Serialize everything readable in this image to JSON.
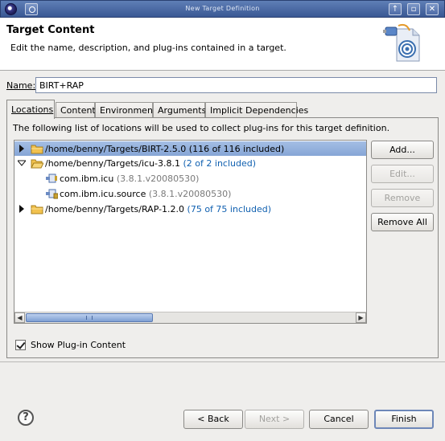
{
  "window": {
    "title": "New Target Definition",
    "app_icon": "eclipse-icon",
    "menu_icon": "window-menu-icon",
    "controls": {
      "minimize": "up-arrow-icon",
      "maximize": "maximize-icon",
      "close": "close-icon"
    }
  },
  "header": {
    "title": "Target Content",
    "description": "Edit the name, description, and plug-ins contained in a target.",
    "icon": "target-wizard-icon"
  },
  "name_field": {
    "label": "Name:",
    "value": "BIRT+RAP"
  },
  "tabs": [
    {
      "label": "Locations",
      "active": true
    },
    {
      "label": "Content",
      "active": false
    },
    {
      "label": "Environment",
      "active": false
    },
    {
      "label": "Arguments",
      "active": false
    },
    {
      "label": "Implicit Dependencies",
      "active": false
    }
  ],
  "locations": {
    "description": "The following list of locations will be used to collect plug-ins for this target definition.",
    "rows": [
      {
        "path": "/home/benny/Targets/BIRT-2.5.0",
        "count": "(116 of 116 included)",
        "expanded": false,
        "selected": true,
        "icon": "folder-icon"
      },
      {
        "path": "/home/benny/Targets/icu-3.8.1",
        "count": "(2 of 2 included)",
        "expanded": true,
        "selected": false,
        "icon": "folder-icon"
      },
      {
        "name": "com.ibm.icu",
        "version": "(3.8.1.v20080530)",
        "icon": "plugin-icon"
      },
      {
        "name": "com.ibm.icu.source",
        "version": "(3.8.1.v20080530)",
        "icon": "source-plugin-icon"
      },
      {
        "path": "/home/benny/Targets/RAP-1.2.0",
        "count": "(75 of 75 included)",
        "expanded": false,
        "selected": false,
        "icon": "folder-icon"
      }
    ],
    "buttons": {
      "add": "Add...",
      "edit": "Edit...",
      "remove": "Remove",
      "remove_all": "Remove All"
    },
    "show_plugin_content": {
      "label": "Show Plug-in Content",
      "checked": true
    }
  },
  "footer": {
    "help_icon": "help-icon",
    "back": "< Back",
    "next": "Next >",
    "cancel": "Cancel",
    "finish": "Finish"
  }
}
